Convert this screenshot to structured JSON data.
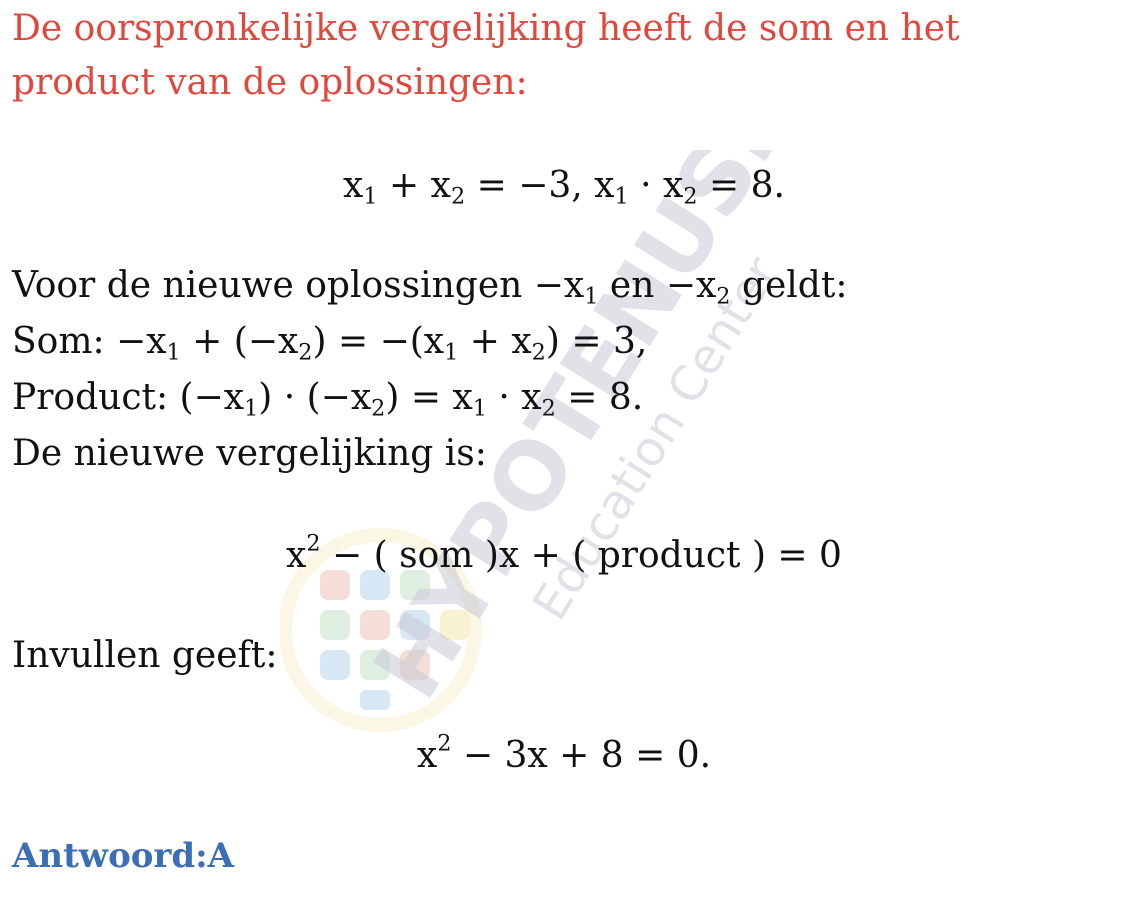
{
  "intro": "De oorspronkelijke vergelijking heeft de som en het product van de oplossingen:",
  "eq_sum_product": {
    "x": "x",
    "i1": "1",
    "i2": "2",
    "sum_op": " + ",
    "sum_rhs": " = −3, ",
    "prod_op": " · ",
    "prod_rhs": " = 8."
  },
  "new_solutions_line": {
    "pre": "Voor de nieuwe oplossingen −x",
    "i1": "1",
    "mid": " en −x",
    "i2": "2",
    "post": " geldt:"
  },
  "som_line": {
    "pre": "Som: −x",
    "i1": "1",
    "p2": " + (−x",
    "i2": "2",
    "p3": ") = −(x",
    "i3": "1",
    "p4": " + x",
    "i4": "2",
    "post": ") = 3,"
  },
  "product_line": {
    "pre": "Product: (−x",
    "i1": "1",
    "p2": ") · (−x",
    "i2": "2",
    "p3": ") = x",
    "i3": "1",
    "p4": " · x",
    "i4": "2",
    "post": " = 8."
  },
  "new_eq_label": "De nieuwe vergelijking is:",
  "general_eq": {
    "x": "x",
    "exp": "2",
    "rest": " − ( som )x + ( product ) = 0"
  },
  "substitute_label": "Invullen geeft:",
  "final_eq": {
    "x": "x",
    "exp": "2",
    "rest": " − 3x + 8 = 0."
  },
  "answer": "Antwoord:A",
  "watermark": {
    "brand": "HYPOTENUSE",
    "tagline": "Education Center",
    "colors": [
      "#c9c9d6",
      "#e8b7a8",
      "#a9cbe8",
      "#b8dcc0",
      "#f0e3a0"
    ]
  }
}
